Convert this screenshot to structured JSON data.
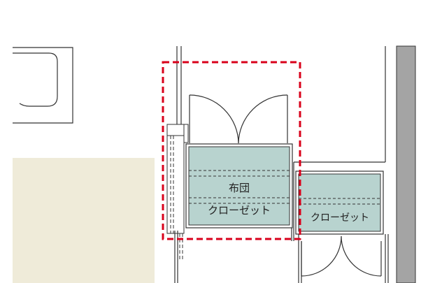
{
  "labels": {
    "futon_closet_line1": "布団",
    "futon_closet_line2": "クローゼット",
    "closet": "クローゼット"
  },
  "colors": {
    "closet_fill": "#b8d3cf",
    "tatami_fill": "#efebd9",
    "highlight": "#d9001b",
    "wall_gray": "#a4a4a4",
    "line": "#333333"
  }
}
